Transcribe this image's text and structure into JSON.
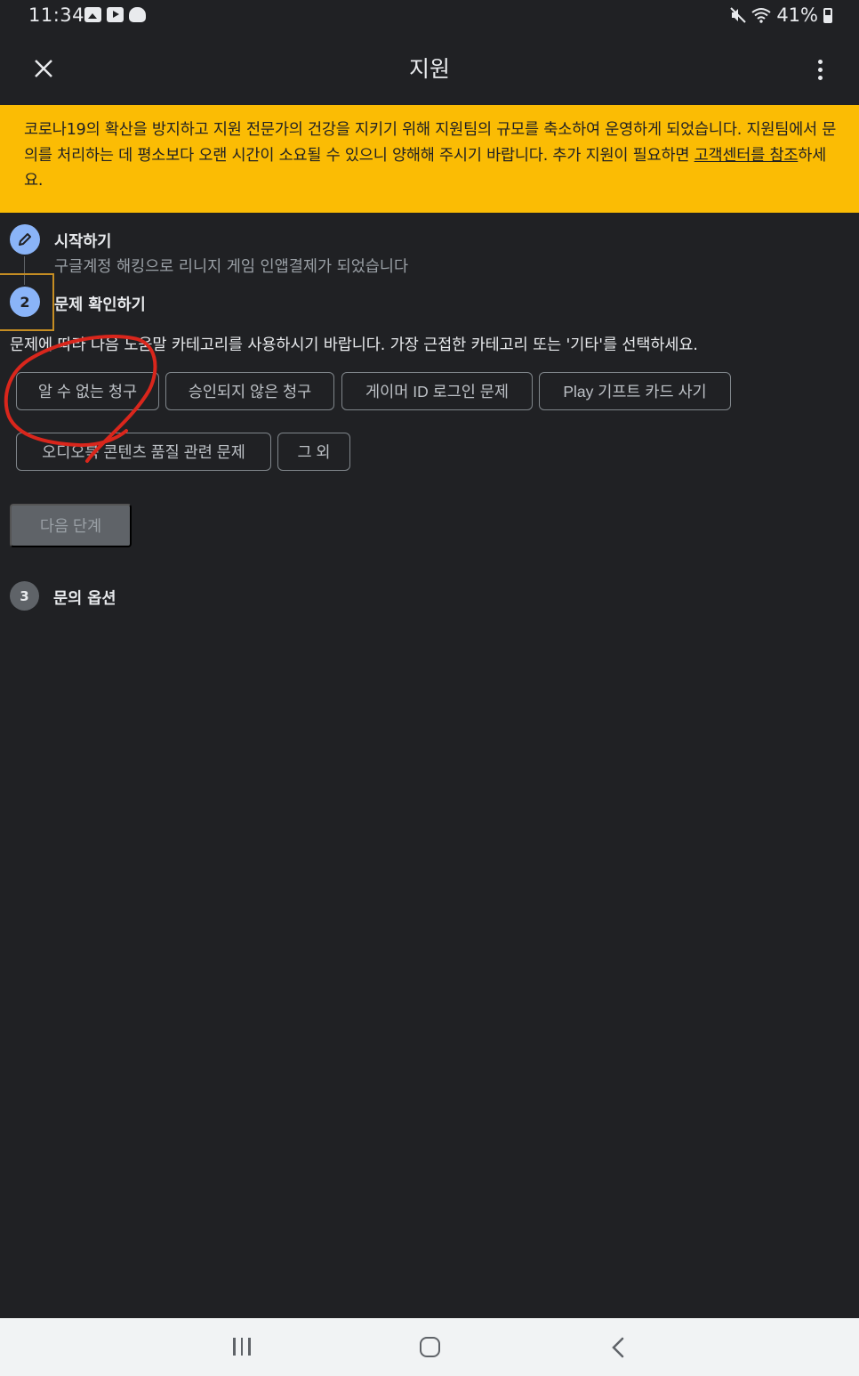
{
  "status_bar": {
    "time": "11:34",
    "battery": "41%",
    "icons_left": [
      "gallery-icon",
      "youtube-icon",
      "cloud-sync-icon"
    ],
    "icons_right": [
      "mute-icon",
      "wifi-icon",
      "battery-icon"
    ]
  },
  "app_bar": {
    "title": "지원",
    "close_icon": "close-icon",
    "more_icon": "more-vert-icon"
  },
  "banner": {
    "text": "코로나19의 확산을 방지하고 지원 전문가의 건강을 지키기 위해 지원팀의 규모를 축소하여 운영하게 되었습니다. 지원팀에서 문의를 처리하는 데 평소보다 오랜 시간이 소요될 수 있으니 양해해 주시기 바랍니다. 추가 지원이 필요하면 ",
    "link": "고객센터를 참조",
    "suffix": "하세요.",
    "bg_color": "#fbbc04"
  },
  "step1": {
    "title": "시작하기",
    "subtitle": "구글계정 해킹으로 리니지 게임 인앱결제가 되었습니다",
    "icon": "pencil-icon"
  },
  "step2": {
    "number": "2",
    "title": "문제 확인하기",
    "instruction": "문제에 따라 다음 도움말 카테고리를 사용하시기 바랍니다. 가장 근접한 카테고리 또는 '기타'를 선택하세요.",
    "categories": [
      "알 수 없는 청구",
      "승인되지 않은 청구",
      "게이머 ID 로그인 문제",
      "Play 기프트 카드 사기",
      "오디오북 콘텐츠 품질 관련 문제",
      "그 외"
    ],
    "next_button": "다음 단계"
  },
  "step3": {
    "number": "3",
    "title": "문의 옵션"
  },
  "nav_bar": {
    "icons": [
      "recent-apps-icon",
      "home-icon",
      "back-icon"
    ]
  },
  "colors": {
    "background": "#202124",
    "accent": "#8ab4f8",
    "annotation": "#d9261c"
  }
}
